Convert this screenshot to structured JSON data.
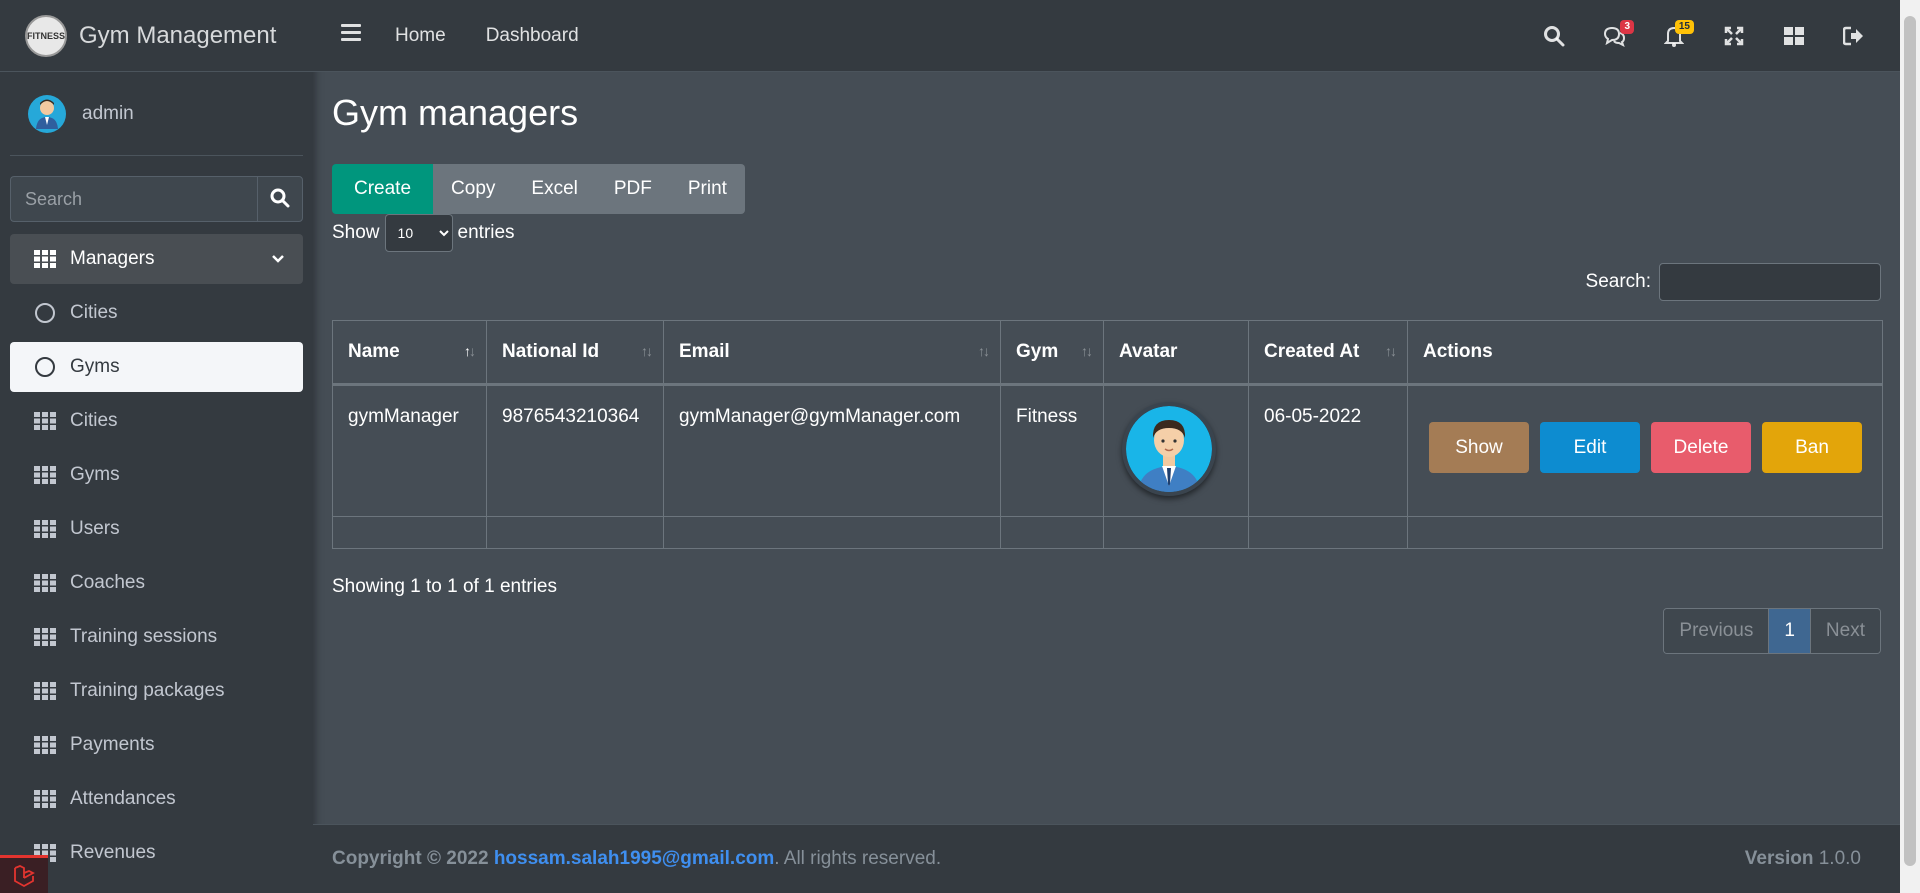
{
  "brand": {
    "logo_text": "FITNESS",
    "title": "Gym Management"
  },
  "user": {
    "name": "admin"
  },
  "sidebar": {
    "search_placeholder": "Search",
    "items": [
      {
        "label": "Managers",
        "icon": "grid-icon",
        "state": "open"
      },
      {
        "label": "Cities",
        "icon": "circle-icon",
        "state": "sub"
      },
      {
        "label": "Gyms",
        "icon": "circle-icon",
        "state": "active"
      },
      {
        "label": "Cities",
        "icon": "grid-icon",
        "state": ""
      },
      {
        "label": "Gyms",
        "icon": "grid-icon",
        "state": ""
      },
      {
        "label": "Users",
        "icon": "grid-icon",
        "state": ""
      },
      {
        "label": "Coaches",
        "icon": "grid-icon",
        "state": ""
      },
      {
        "label": "Training sessions",
        "icon": "grid-icon",
        "state": ""
      },
      {
        "label": "Training packages",
        "icon": "grid-icon",
        "state": ""
      },
      {
        "label": "Payments",
        "icon": "grid-icon",
        "state": ""
      },
      {
        "label": "Attendances",
        "icon": "grid-icon",
        "state": ""
      },
      {
        "label": "Revenues",
        "icon": "grid-icon",
        "state": ""
      }
    ]
  },
  "topbar": {
    "links": [
      "Home",
      "Dashboard"
    ],
    "messages_badge": "3",
    "notifications_badge": "15"
  },
  "page": {
    "title": "Gym managers",
    "buttons": [
      "Create",
      "Copy",
      "Excel",
      "PDF",
      "Print"
    ],
    "show_label": "Show",
    "entries_value": "10",
    "entries_label": "entries",
    "search_label": "Search:"
  },
  "table": {
    "headers": [
      "Name",
      "National Id",
      "Email",
      "Gym",
      "Avatar",
      "Created At",
      "Actions"
    ],
    "rows": [
      {
        "name": "gymManager",
        "national_id": "9876543210364",
        "email": "gymManager@gymManager.com",
        "gym": "Fitness",
        "created_at": "06-05-2022",
        "actions": [
          "Show",
          "Edit",
          "Delete",
          "Ban"
        ]
      }
    ]
  },
  "info": "Showing 1 to 1 of 1 entries",
  "pagination": {
    "previous": "Previous",
    "current": "1",
    "next": "Next"
  },
  "footer": {
    "copyright": "Copyright © 2022",
    "email": "hossam.salah1995@gmail.com",
    "rights": ". All rights reserved.",
    "version_label": "Version",
    "version": "1.0.0"
  },
  "colors": {
    "create": "#00967d",
    "show": "#a47c55",
    "edit": "#0d8cd0",
    "delete": "#e85c6c",
    "ban": "#e3a50a",
    "link": "#3f8ff0"
  }
}
